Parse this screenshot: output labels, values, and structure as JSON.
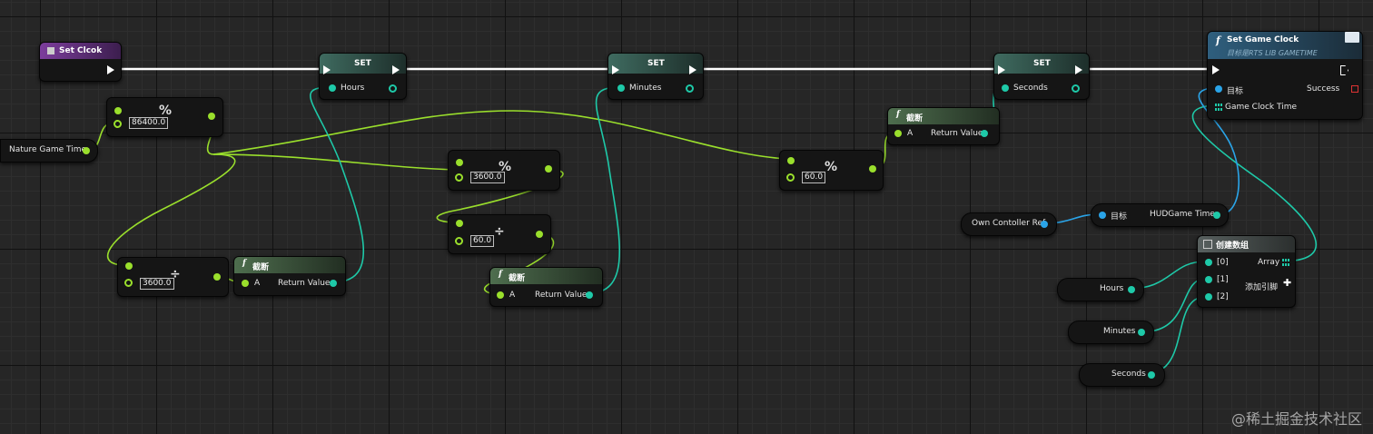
{
  "set_clock": {
    "title": "Set Clcok"
  },
  "set_hours": {
    "title": "SET",
    "var": "Hours"
  },
  "set_minutes": {
    "title": "SET",
    "var": "Minutes"
  },
  "set_seconds": {
    "title": "SET",
    "var": "Seconds"
  },
  "set_game_clock": {
    "title": "Set Game Clock",
    "subtitle": "目标是RTS LIB GAMETIME",
    "target": "目标",
    "success": "Success",
    "game_clock_time": "Game Clock Time"
  },
  "nature_game_time": {
    "label": "Nature Game Time"
  },
  "mod_86400": {
    "value": "86400.0",
    "op": "%"
  },
  "div_3600": {
    "value": "3600.0",
    "op": "÷"
  },
  "trunc_hours": {
    "title": "截断",
    "a": "A",
    "ret": "Return Value"
  },
  "mod_3600": {
    "value": "3600.0",
    "op": "%"
  },
  "div_60": {
    "value": "60.0",
    "op": "÷"
  },
  "trunc_minutes": {
    "title": "截断",
    "a": "A",
    "ret": "Return Value"
  },
  "mod_60": {
    "value": "60.0",
    "op": "%"
  },
  "trunc_seconds": {
    "title": "截断",
    "a": "A",
    "ret": "Return Value"
  },
  "own_controller_ref": {
    "label": "Own Contoller Ref"
  },
  "hud_game_time": {
    "target": "目标",
    "ret": "HUDGame Time"
  },
  "make_array": {
    "title": "创建数组",
    "i0": "[0]",
    "i1": "[1]",
    "i2": "[2]",
    "array": "Array",
    "add_pin": "添加引脚"
  },
  "get_hours": {
    "label": "Hours"
  },
  "get_minutes": {
    "label": "Minutes"
  },
  "get_seconds": {
    "label": "Seconds"
  },
  "watermark": "@稀土掘金技术社区",
  "colors": {
    "float_wire": "#9adf2c",
    "int_wire": "#1ec9a8",
    "object_wire": "#2aa4e8",
    "exec_wire": "#ffffff"
  }
}
